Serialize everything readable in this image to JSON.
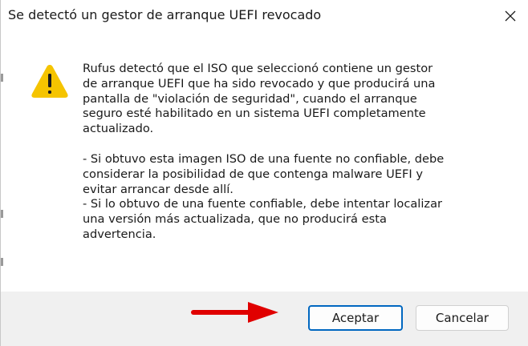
{
  "dialog": {
    "title": "Se detectó un gestor de arranque UEFI revocado",
    "close_icon": "close-icon",
    "warning_icon": "warning-icon",
    "message_paragraph1": "Rufus detectó que el ISO que seleccionó contiene un gestor\nde arranque UEFI que ha sido revocado y que producirá una\npantalla de \"violación de seguridad\", cuando el arranque\nseguro esté habilitado en un sistema UEFI completamente\nactualizado.",
    "message_paragraph2": "- Si obtuvo esta imagen ISO de una fuente no confiable, debe\nconsiderar la posibilidad de que contenga malware UEFI y\nevitar arrancar desde allí.\n- Si lo obtuvo de una fuente confiable, debe intentar localizar\nuna versión más actualizada, que no producirá esta\nadvertencia.",
    "accept_label": "Aceptar",
    "cancel_label": "Cancelar"
  },
  "annotation": {
    "arrow_color": "#e00000"
  },
  "colors": {
    "accent": "#0067c0",
    "warning": "#f5c400",
    "footer_bg": "#f0f0f0"
  }
}
